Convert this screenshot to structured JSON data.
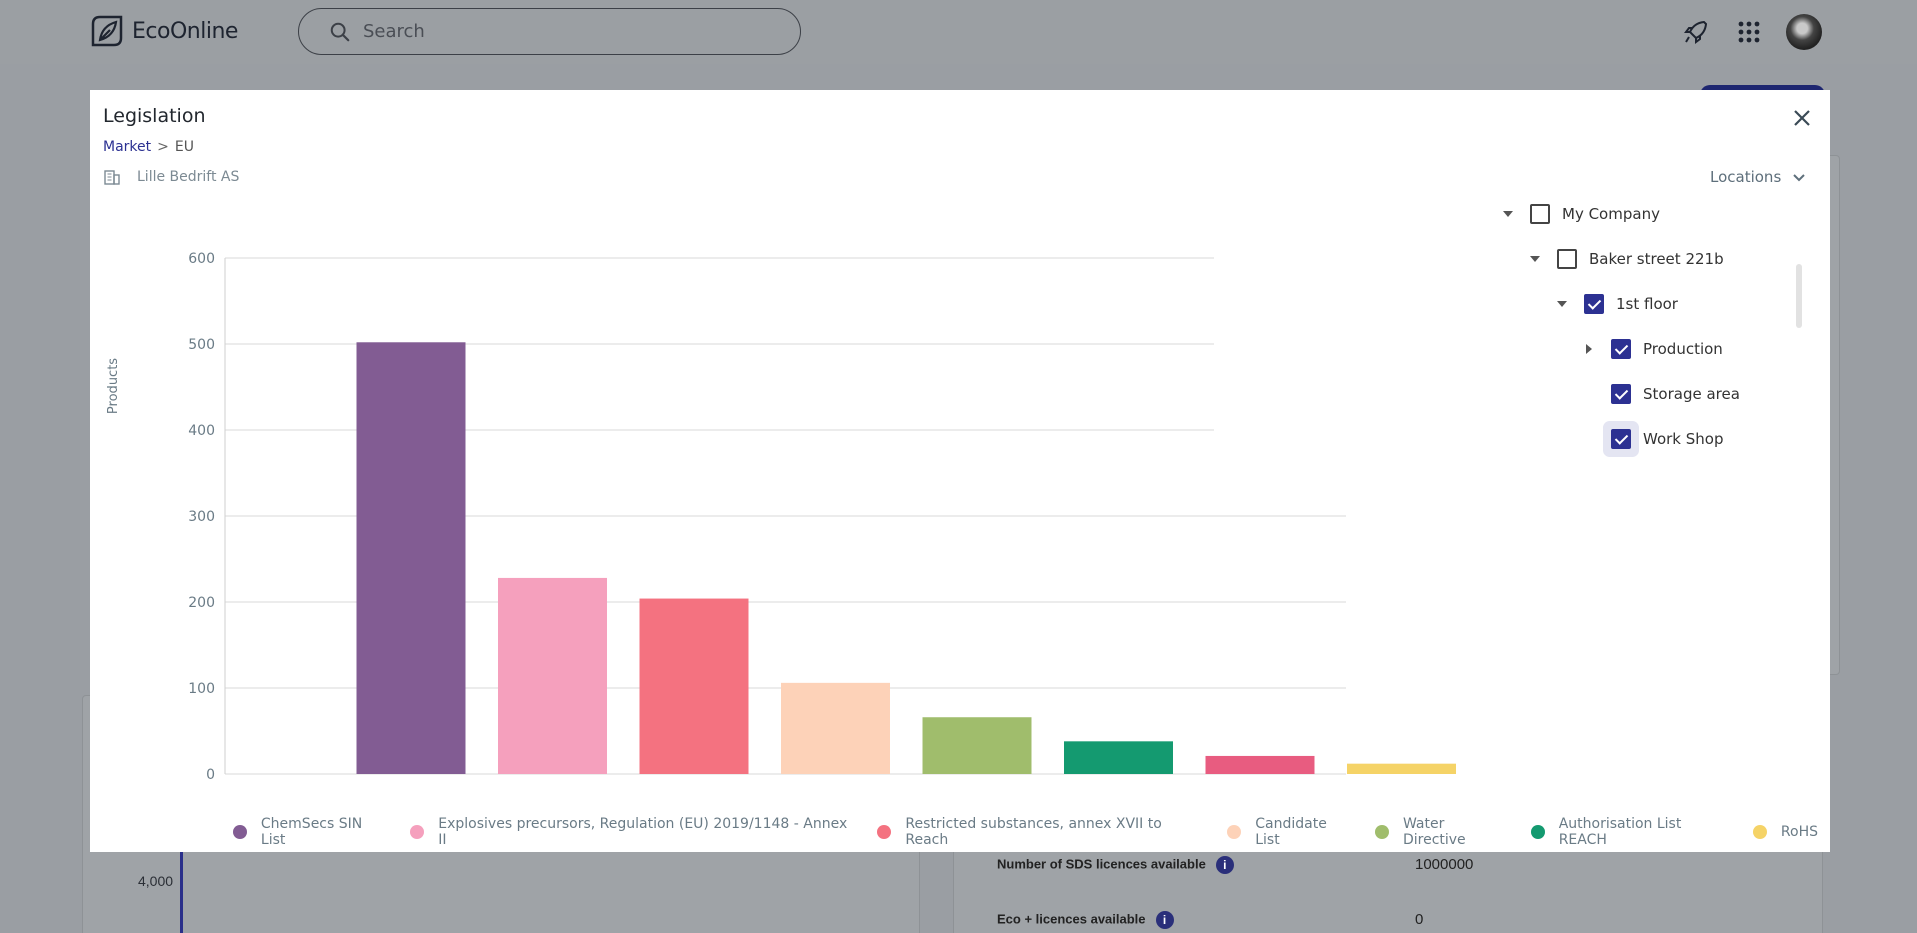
{
  "header": {
    "brand": "EcoOnline",
    "search_placeholder": "Search",
    "icons": [
      "rocket-icon",
      "apps-grid-icon",
      "user-avatar"
    ]
  },
  "background": {
    "axis_tick": "4,000",
    "rows": [
      {
        "label": "Number of SDS licences available",
        "value": "1000000"
      },
      {
        "label": "Eco + licences available",
        "value": "0"
      }
    ]
  },
  "modal": {
    "title": "Legislation",
    "breadcrumb": {
      "parent": "Market",
      "separator": ">",
      "current": "EU"
    },
    "company": "Lille Bedrift AS",
    "locations_label": "Locations"
  },
  "tree": [
    {
      "label": "My Company",
      "checked": false,
      "caret": "down"
    },
    {
      "label": "Baker street 221b",
      "checked": false,
      "caret": "down"
    },
    {
      "label": "1st floor",
      "checked": true,
      "caret": "down"
    },
    {
      "label": "Production",
      "checked": true,
      "caret": "right"
    },
    {
      "label": "Storage area",
      "checked": true,
      "caret": "none"
    },
    {
      "label": "Work Shop",
      "checked": true,
      "caret": "none"
    }
  ],
  "chart_data": {
    "type": "bar",
    "title": "",
    "xlabel": "",
    "ylabel": "Products",
    "ylim": [
      0,
      600
    ],
    "yticks": [
      0,
      100,
      200,
      300,
      400,
      500,
      600
    ],
    "grid": true,
    "legend_placement": "bottom",
    "categories": [
      "ChemSecs SIN List",
      "Explosives precursors, Regulation (EU) 2019/1148 - Annex II",
      "Restricted substances, annex XVII to Reach",
      "Candidate List",
      "Water Directive",
      "Authorisation List REACH",
      "",
      "RoHS"
    ],
    "values": [
      502,
      228,
      204,
      106,
      66,
      38,
      21,
      12
    ],
    "colors": [
      "#825c93",
      "#f5a0bd",
      "#f47280",
      "#fdd2b8",
      "#a0bd6c",
      "#149a70",
      "#e85c80",
      "#f5d367"
    ],
    "legend": [
      {
        "name": "ChemSecs SIN List",
        "color": "#825c93"
      },
      {
        "name": "Explosives precursors, Regulation (EU) 2019/1148 - Annex II",
        "color": "#f5a0bd"
      },
      {
        "name": "Restricted substances, annex XVII to Reach",
        "color": "#f47280"
      },
      {
        "name": "Candidate List",
        "color": "#fdd2b8"
      },
      {
        "name": "Water Directive",
        "color": "#a0bd6c"
      },
      {
        "name": "Authorisation List REACH",
        "color": "#149a70"
      },
      {
        "name": "RoHS",
        "color": "#f5d367"
      }
    ]
  }
}
